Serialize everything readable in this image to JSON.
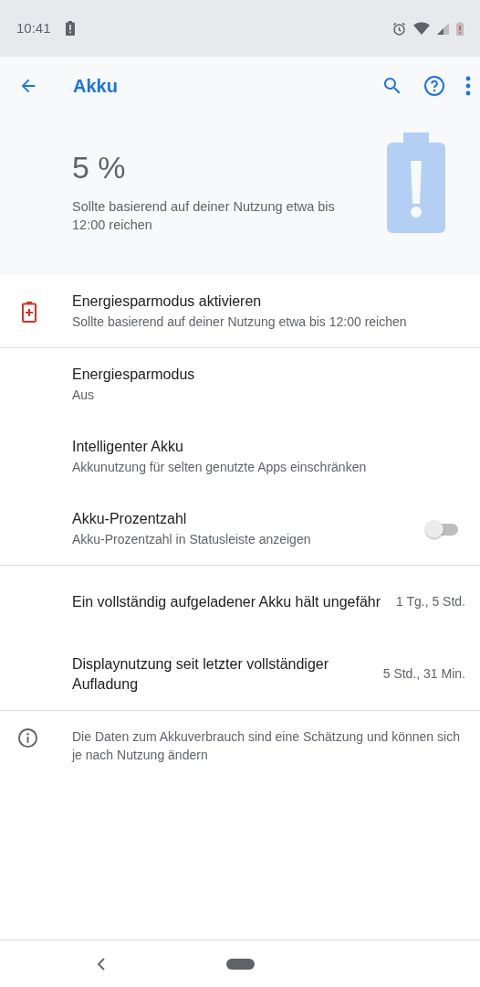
{
  "status_bar": {
    "time": "10:41"
  },
  "app_bar": {
    "title": "Akku"
  },
  "header": {
    "percent": "5 %",
    "estimate": "Sollte basierend auf deiner Nutzung etwa bis 12:00 reichen"
  },
  "sections": [
    [
      {
        "kind": "icon",
        "title": "Energiesparmodus aktivieren",
        "summary": "Sollte basierend auf deiner Nutzung etwa bis 12:00 reichen"
      }
    ],
    [
      {
        "kind": "plain",
        "title": "Energiesparmodus",
        "summary": "Aus"
      },
      {
        "kind": "plain",
        "title": "Intelligenter Akku",
        "summary": "Akkunutzung für selten genutzte Apps einschränken"
      },
      {
        "kind": "toggle",
        "title": "Akku-Prozentzahl",
        "summary": "Akku-Prozentzahl in Statusleiste anzeigen",
        "on": false
      }
    ],
    [
      {
        "kind": "value",
        "title": "Ein vollständig aufgeladener Akku hält ungefähr",
        "value": "1 Tg., 5 Std."
      },
      {
        "kind": "value",
        "title": "Displaynutzung seit letzter vollständiger Aufladung",
        "value": "5 Std., 31 Min."
      }
    ]
  ],
  "footer": {
    "text": "Die Daten zum Akkuverbrauch sind eine Schätzung und können sich je nach Nutzung ändern"
  }
}
